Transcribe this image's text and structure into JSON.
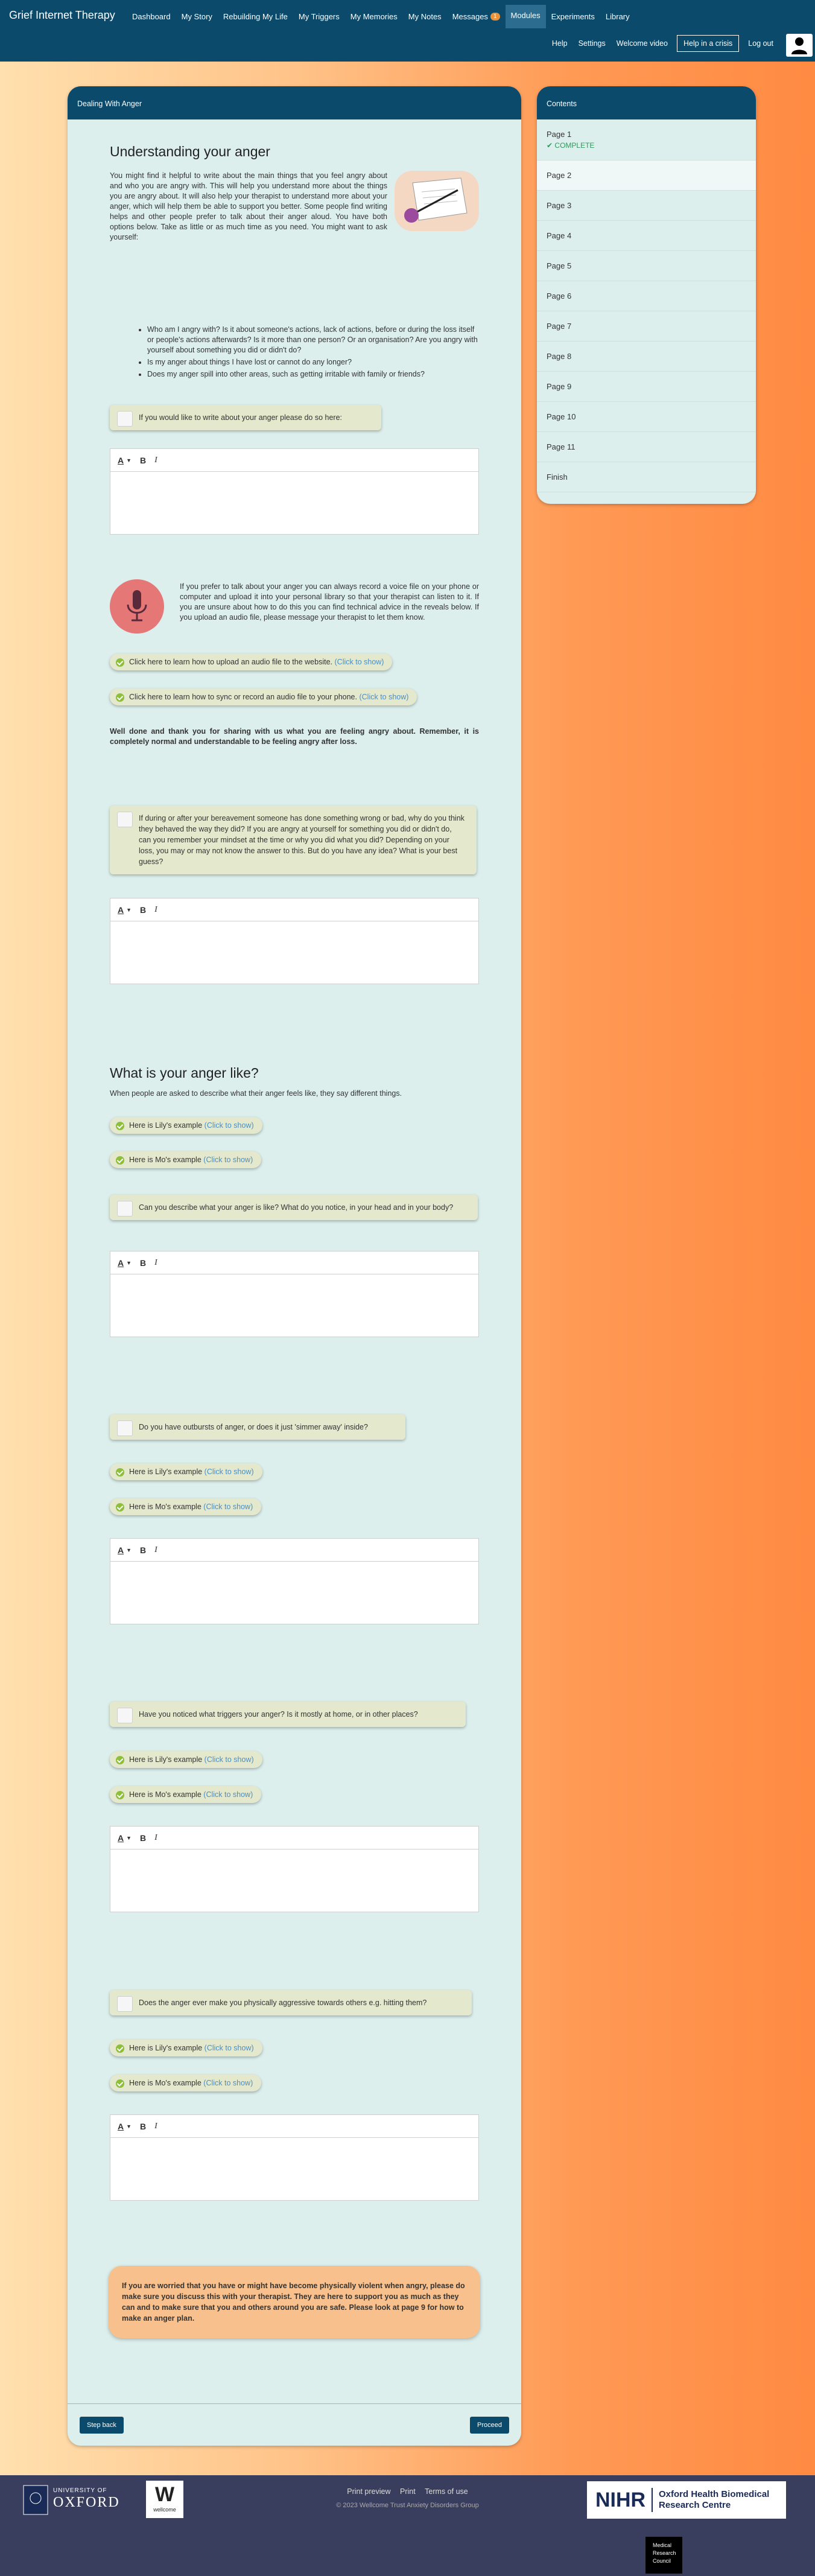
{
  "app": {
    "title": "Grief Internet Therapy"
  },
  "nav": {
    "items": [
      {
        "label": "Dashboard"
      },
      {
        "label": "My Story"
      },
      {
        "label": "Rebuilding My Life"
      },
      {
        "label": "My Triggers"
      },
      {
        "label": "My Memories"
      },
      {
        "label": "My Notes"
      },
      {
        "label": "Messages",
        "badge": "1"
      },
      {
        "label": "Modules",
        "active": true
      },
      {
        "label": "Experiments"
      },
      {
        "label": "Library"
      }
    ],
    "secondary": [
      "Help",
      "Settings",
      "Welcome video",
      "Help in a crisis",
      "Log out"
    ]
  },
  "main": {
    "heading": "Dealing With Anger",
    "section1": {
      "title": "Understanding your anger",
      "intro": "You might find it helpful to write about the main things that you feel angry about and who you are angry with. This will help you understand more about the things you are angry about. It will also help your therapist to understand more about your anger, which will help them be able to support you better. Some people find writing helps and other people prefer to talk about their anger aloud. You have both options below. Take as little or as much time as you need. You might want to ask yourself:",
      "questions": [
        "Who am I angry with? Is it about someone's actions, lack of actions, before or during the loss itself or people's actions afterwards? Is it more than one person? Or an organisation? Are you angry with yourself about something you did or didn't do?",
        "Is my anger about things I have lost or cannot do any longer?",
        "Does my anger spill into other areas, such as getting irritable with family or friends?"
      ],
      "write_prompt": "If you would like to write about your anger please do so here:",
      "audio_text": "If you prefer to talk about your anger you can always record a voice file on your phone or computer and upload it into your personal library so that your therapist can listen to it. If you are unsure about how to do this you can find technical advice in the reveals below. If you upload an audio file, please message your therapist to let them know.",
      "reveal_upload": "Click here to learn how to upload an audio file to the website.",
      "reveal_sync": "Click here to learn how to sync or record an audio file to your phone.",
      "click_to_show": "(Click to show)",
      "well_done": "Well done and thank you for sharing with us what you are feeling angry about. Remember, it is completely normal and understandable to be feeling angry after loss.",
      "bereavement_prompt": "If during or after your bereavement someone has done something wrong or bad, why do you think they behaved the way they did? If you are angry at yourself for something you did or didn't do, can you remember your mindset at the time or why you did what you did? Depending on your loss, you may or may not know the answer to this. But do you have any idea? What is your best guess?"
    },
    "section2": {
      "title": "What is your anger like?",
      "intro": "When people are asked to describe what their anger feels like, they say different things.",
      "lily": "Here is Lily's example",
      "mo": "Here is Mo's example",
      "q1": "Can you describe what your anger is like? What do you notice, in your head and in your body?",
      "q2": "Do you have outbursts of anger, or does it just 'simmer away' inside?",
      "q3": "Have you noticed what triggers your anger? Is it mostly at home, or in other places?",
      "q4": "Does the anger ever make you physically aggressive towards others e.g. hitting them?"
    },
    "warning": "If you are worried that you have or might have become physically violent when angry, please do make sure you discuss this with your therapist. They are here to support you as much as they can and to make sure that you and others around you are safe. Please look at page 9 for how to make an anger plan.",
    "step_back": "Step back",
    "proceed": "Proceed"
  },
  "toolbar": {
    "tt": "A",
    "bold": "B",
    "italic": "I"
  },
  "sidebar": {
    "heading": "Contents",
    "pages": [
      {
        "label": "Page 1",
        "status": "COMPLETE"
      },
      {
        "label": "Page 2"
      },
      {
        "label": "Page 3"
      },
      {
        "label": "Page 4"
      },
      {
        "label": "Page 5"
      },
      {
        "label": "Page 6"
      },
      {
        "label": "Page 7"
      },
      {
        "label": "Page 8"
      },
      {
        "label": "Page 9"
      },
      {
        "label": "Page 10"
      },
      {
        "label": "Page 11"
      },
      {
        "label": "Finish"
      }
    ]
  },
  "footer": {
    "links": [
      "Print preview",
      "Print",
      "Terms of use"
    ],
    "copyright": "© 2023 Wellcome Trust Anxiety Disorders Group",
    "oxford_small": "UNIVERSITY OF",
    "oxford_big": "OXFORD",
    "wellcome": "wellcome",
    "nihr": "NIHR",
    "nihr_sub": "Oxford Health Biomedical Research Centre",
    "mrc_lines": [
      "Medical",
      "Research",
      "Council"
    ]
  }
}
